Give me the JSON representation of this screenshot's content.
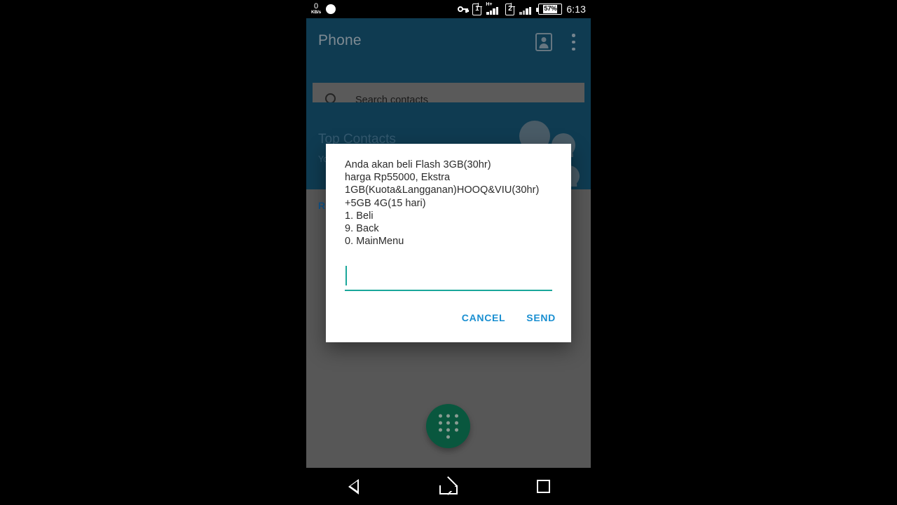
{
  "statusbar": {
    "net_speed_value": "0",
    "net_speed_unit": "KB/s",
    "notification_dot": "notification-dot",
    "vpn_key_icon": "key-icon",
    "sim1_label": "1",
    "sim1_network": "H+",
    "sim2_label": "2",
    "battery_percent": "57%",
    "clock": "6:13"
  },
  "app": {
    "title": "Phone",
    "contacts_icon": "contact-card-icon",
    "overflow_icon": "more-vertical-icon",
    "search": {
      "icon": "search-icon",
      "placeholder": "Search contacts",
      "value": ""
    },
    "top_contacts": {
      "heading": "Top Contacts",
      "subtext": "Yo"
    },
    "recents_section": "R",
    "fab": {
      "icon": "dialpad-icon",
      "color": "#0c6b4c"
    }
  },
  "dialog": {
    "message": "Anda akan beli Flash 3GB(30hr)\nharga Rp55000, Ekstra\n1GB(Kuota&Langganan)HOOQ&VIU(30hr)\n+5GB 4G(15 hari)\n1. Beli\n9. Back\n0. MainMenu",
    "menu_options": [
      {
        "key": "1",
        "label": "Beli"
      },
      {
        "key": "9",
        "label": "Back"
      },
      {
        "key": "0",
        "label": "MainMenu"
      }
    ],
    "offer": {
      "product": "Flash 3GB(30hr)",
      "price": "Rp55000",
      "extras": "1GB(Kuota&Langganan)HOOQ&VIU(30hr) +5GB 4G(15 hari)"
    },
    "input": {
      "value": "",
      "placeholder": "",
      "accent_color": "#1aa79a"
    },
    "cancel_label": "CANCEL",
    "send_label": "SEND",
    "button_color": "#1a8fd1"
  },
  "navbar": {
    "back_icon": "back-triangle-icon",
    "home_icon": "home-icon",
    "recents_icon": "recents-square-icon"
  }
}
